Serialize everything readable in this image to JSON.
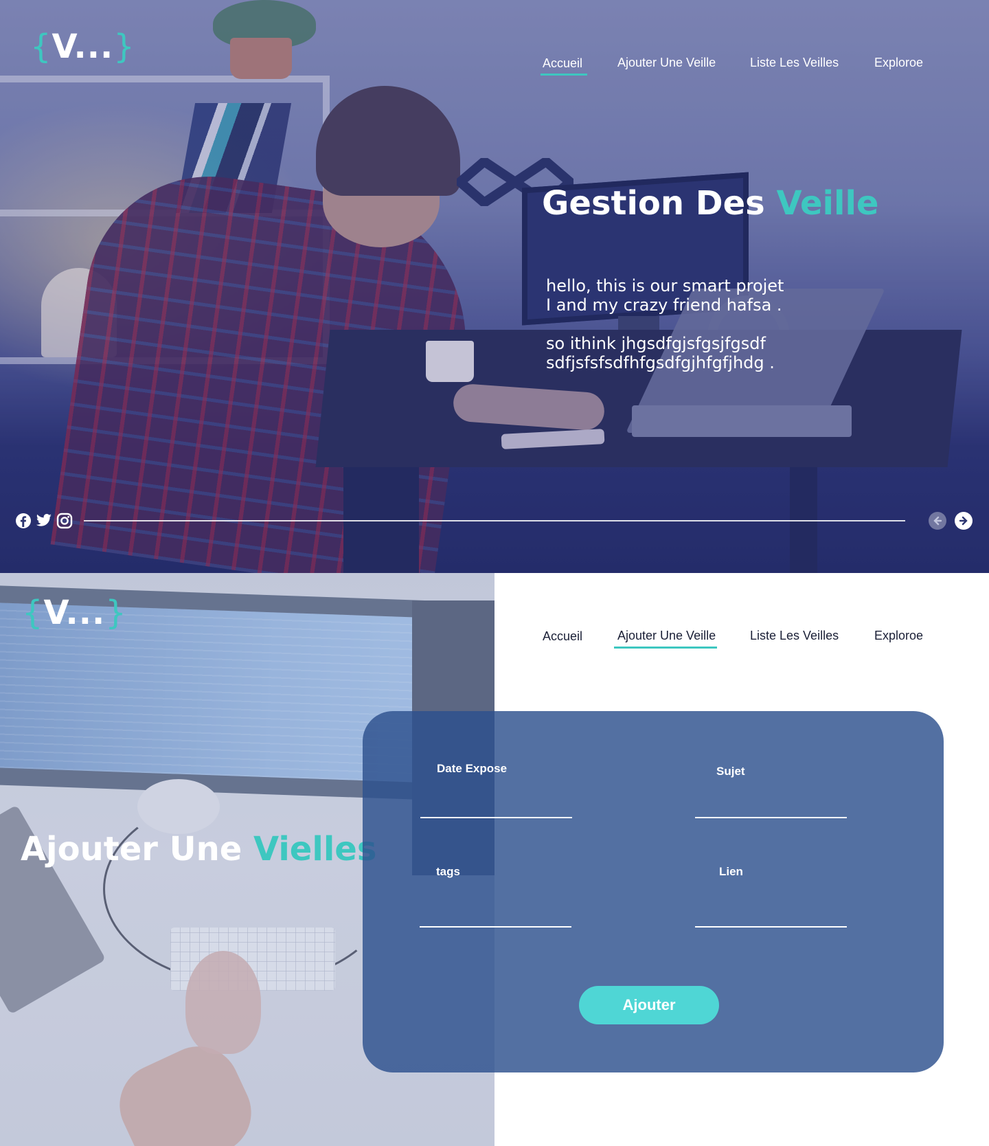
{
  "brand": {
    "brace_open": "{",
    "letter": "V...",
    "brace_close": "}"
  },
  "nav": {
    "items": [
      "Accueil",
      "Ajouter Une Veille",
      "Liste Les Veilles",
      "Exploroe"
    ]
  },
  "hero": {
    "title_main": "Gestion Des ",
    "title_accent": "Veille",
    "intro_p1_line1": "hello, this is our smart projet",
    "intro_p1_line2": "I and my crazy friend hafsa .",
    "intro_p2_line1": "so ithink jhgsdfgjsfgsjfgsdf",
    "intro_p2_line2": "sdfjsfsfsdfhfgsdfgjhfgfjhdg .",
    "social_icons": [
      "facebook-icon",
      "twitter-icon",
      "instagram-icon"
    ],
    "active_nav": "Accueil"
  },
  "form_section": {
    "title_main": "Ajouter Une ",
    "title_accent": "Vielles",
    "active_nav": "Ajouter Une Veille",
    "fields": {
      "date_label": "Date Expose",
      "sujet_label": "Sujet",
      "tags_label": "tags",
      "lien_label": "Lien"
    },
    "submit_label": "Ajouter"
  },
  "colors": {
    "accent": "#3ec7c0",
    "button": "#4fd6d5",
    "form_card": "#2d508e",
    "hero_overlay": "#2d377d"
  }
}
